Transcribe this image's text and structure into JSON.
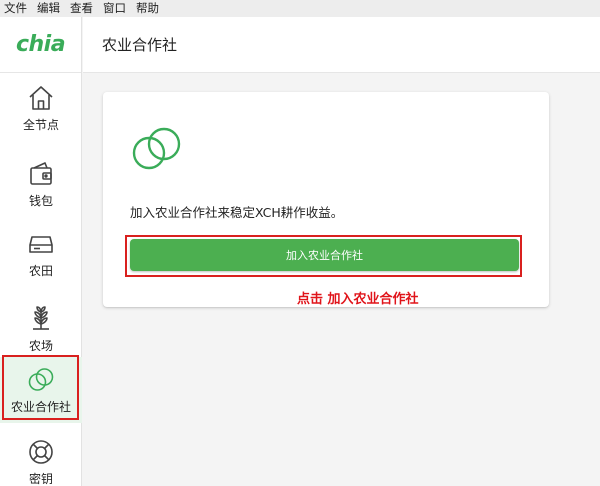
{
  "menu": [
    "文件",
    "编辑",
    "查看",
    "窗口",
    "帮助"
  ],
  "brand": {
    "logo_text": "chia",
    "color": "#3aac59"
  },
  "header": {
    "title": "农业合作社"
  },
  "sidebar": {
    "items": [
      {
        "label": "全节点",
        "icon": "home-icon"
      },
      {
        "label": "钱包",
        "icon": "wallet-icon"
      },
      {
        "label": "农田",
        "icon": "storage-drive-icon"
      },
      {
        "label": "农场",
        "icon": "plant-icon"
      },
      {
        "label": "农业合作社",
        "icon": "pool-rings-icon",
        "active": true
      },
      {
        "label": "密钥",
        "icon": "lifebuoy-icon"
      }
    ]
  },
  "card": {
    "icon": "pool-rings-icon",
    "description": "加入农业合作社来稳定XCH耕作收益。",
    "join_button": "加入农业合作社"
  },
  "annotation": {
    "text": "点击 加入农业合作社",
    "color": "#e0141a"
  },
  "colors": {
    "accent": "#4caf50",
    "highlight_box": "#d9201e"
  }
}
